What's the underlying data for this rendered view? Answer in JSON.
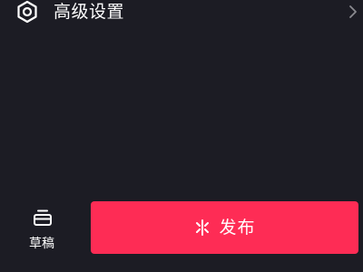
{
  "settings_row": {
    "label": "高级设置",
    "icon": "hexagon-settings-icon",
    "chevron": "chevron-right-icon"
  },
  "drafts": {
    "label": "草稿",
    "icon": "drafts-box-icon"
  },
  "publish": {
    "label": "发布",
    "icon": "sparkle-icon"
  },
  "colors": {
    "background": "#1c1c24",
    "accent": "#fe2c55",
    "text": "#ffffff"
  }
}
